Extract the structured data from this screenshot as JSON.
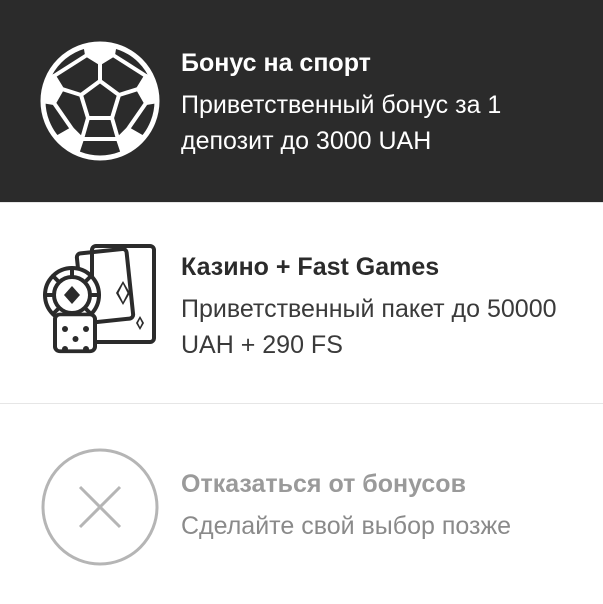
{
  "options": [
    {
      "title": "Бонус на спорт",
      "description": "Приветственный бонус за 1 депозит до 3000 UAH",
      "icon": "soccer-ball-icon"
    },
    {
      "title": "Казино + Fast Games",
      "description": "Приветственный пакет до 50000 UAH + 290 FS",
      "icon": "casino-chip-cards-dice-icon"
    },
    {
      "title": "Отказаться от бонусов",
      "description": "Сделайте свой выбор позже",
      "icon": "close-circle-icon"
    }
  ],
  "colors": {
    "selected_background": "#2b2b2b",
    "background": "#ffffff",
    "muted_text": "#9a9a9a"
  }
}
